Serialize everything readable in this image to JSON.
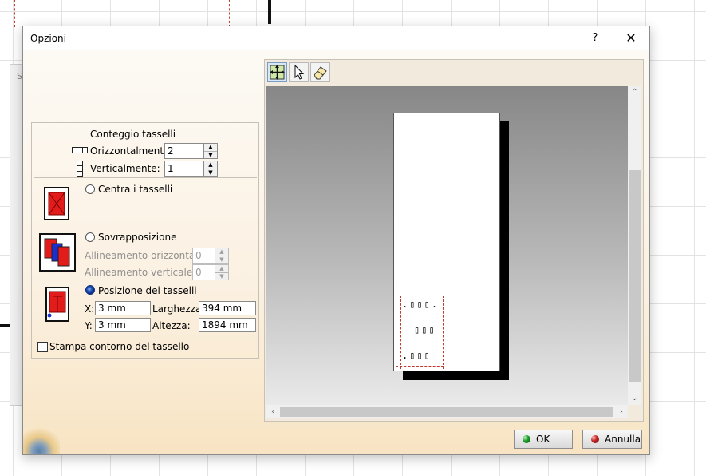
{
  "dialog": {
    "title": "Opzioni",
    "help_label": "?",
    "close_label": "✕"
  },
  "background": {
    "fragment_label": "S"
  },
  "tile_count": {
    "heading": "Conteggio tasselli",
    "horizontal_label": "Orizzontalmente:",
    "horizontal_value": "2",
    "vertical_label": "Verticalmente:",
    "vertical_value": "1"
  },
  "modes": {
    "center_label": "Centra i tasselli",
    "overlap_label": "Sovrapposizione",
    "horizontal_alignment_label": "Allineamento orizzontale",
    "horizontal_alignment_value": "0",
    "vertical_alignment_label": "Allineamento verticale",
    "vertical_alignment_value": "0",
    "position_label": "Posizione dei tasselli",
    "selected": "position"
  },
  "position": {
    "x_label": "X:",
    "x_value": "3 mm",
    "y_label": "Y:",
    "y_value": "3 mm",
    "width_label": "Larghezza:",
    "width_value": "394 mm",
    "height_label": "Altezza:",
    "height_value": "1894 mm"
  },
  "print_outline_label": "Stampa contorno del tassello",
  "print_outline_checked": false,
  "preview": {
    "tools": [
      "move-fit-icon",
      "pointer-icon",
      "eraser-icon"
    ],
    "active_tool": "move-fit-icon",
    "content_rows": [
      ".▯▯▯.",
      "▯▯▯",
      ".▯▯▯"
    ]
  },
  "buttons": {
    "ok_label": "OK",
    "cancel_label": "Annulla"
  },
  "colors": {
    "ok_dot": "#1fa02e",
    "cancel_dot": "#c62828",
    "tile_red": "#e21b1b",
    "tile_blue": "#1b2fd1"
  }
}
